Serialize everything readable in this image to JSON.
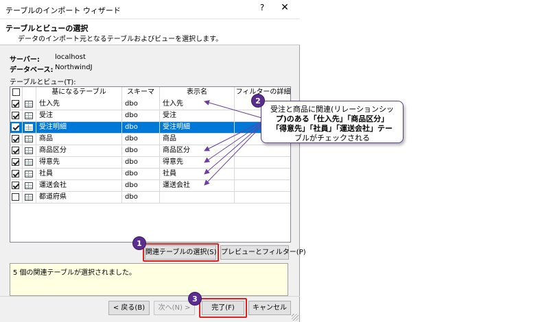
{
  "window": {
    "title": "テーブルのインポート ウィザード",
    "help_glyph": "?",
    "close_glyph": "✕"
  },
  "header": {
    "title": "テーブルとビューの選択",
    "subtitle": "データのインポート元となるテーブルおよびビューを選択します。"
  },
  "connection": {
    "server_label": "サーバー:",
    "server_value": "localhost",
    "database_label": "データベース:",
    "database_value": "NorthwindJ"
  },
  "grid": {
    "label": "テーブルとビュー(T):",
    "columns": [
      "基になるテーブル",
      "スキーマ",
      "表示名",
      "フィルターの詳細"
    ],
    "rows": [
      {
        "checked": true,
        "base": "仕入先",
        "schema": "dbo",
        "display": "仕入先",
        "selected": false
      },
      {
        "checked": true,
        "base": "受注",
        "schema": "dbo",
        "display": "受注",
        "selected": false
      },
      {
        "checked": true,
        "base": "受注明細",
        "schema": "dbo",
        "display": "受注明細",
        "selected": true
      },
      {
        "checked": true,
        "base": "商品",
        "schema": "dbo",
        "display": "商品",
        "selected": false
      },
      {
        "checked": true,
        "base": "商品区分",
        "schema": "dbo",
        "display": "商品区分",
        "selected": false
      },
      {
        "checked": true,
        "base": "得意先",
        "schema": "dbo",
        "display": "得意先",
        "selected": false
      },
      {
        "checked": true,
        "base": "社員",
        "schema": "dbo",
        "display": "社員",
        "selected": false
      },
      {
        "checked": true,
        "base": "運送会社",
        "schema": "dbo",
        "display": "運送会社",
        "selected": false
      },
      {
        "checked": false,
        "base": "都道府県",
        "schema": "dbo",
        "display": "",
        "selected": false
      }
    ]
  },
  "buttons": {
    "select_related": "関連テーブルの選択(S)",
    "preview_filter": "プレビューとフィルター(P)",
    "back": "< 戻る(B)",
    "next": "次へ(N) >",
    "finish": "完了(F)",
    "cancel": "キャンセル"
  },
  "status": {
    "message": "5 個の関連テーブルが選択されました。"
  },
  "annotations": {
    "badge_1": "1",
    "badge_2": "2",
    "badge_3": "3",
    "callout_line1": "受注と商品に関連(リレーションシッ",
    "callout_line2": "プ)のある「仕入先」「商品区分」",
    "callout_line3": "「得意先」「社員」「運送会社」テー",
    "callout_line4": "ブルがチェックされる",
    "badge_color": "#5b2d8e",
    "highlight_color": "#e0201c",
    "selection_color": "#0078d7"
  }
}
